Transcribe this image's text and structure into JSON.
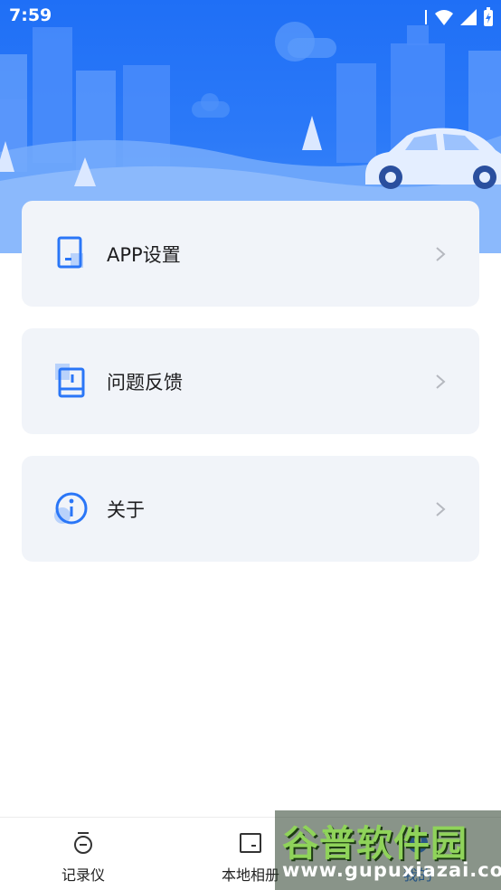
{
  "status_bar": {
    "time": "7:59"
  },
  "menu": {
    "items": [
      {
        "label": "APP设置"
      },
      {
        "label": "问题反馈"
      },
      {
        "label": "关于"
      }
    ]
  },
  "bottom_nav": {
    "items": [
      {
        "label": "记录仪",
        "icon": "dashcam-icon"
      },
      {
        "label": "本地相册",
        "icon": "album-icon"
      },
      {
        "label": "我的",
        "icon": "profile-icon"
      }
    ]
  },
  "watermark": {
    "title": "谷普软件园",
    "url": "www.gupuxiazai.com"
  },
  "colors": {
    "accent": "#2a76f7",
    "card_bg": "#f1f4f9",
    "banner_top": "#1f6ff6"
  }
}
